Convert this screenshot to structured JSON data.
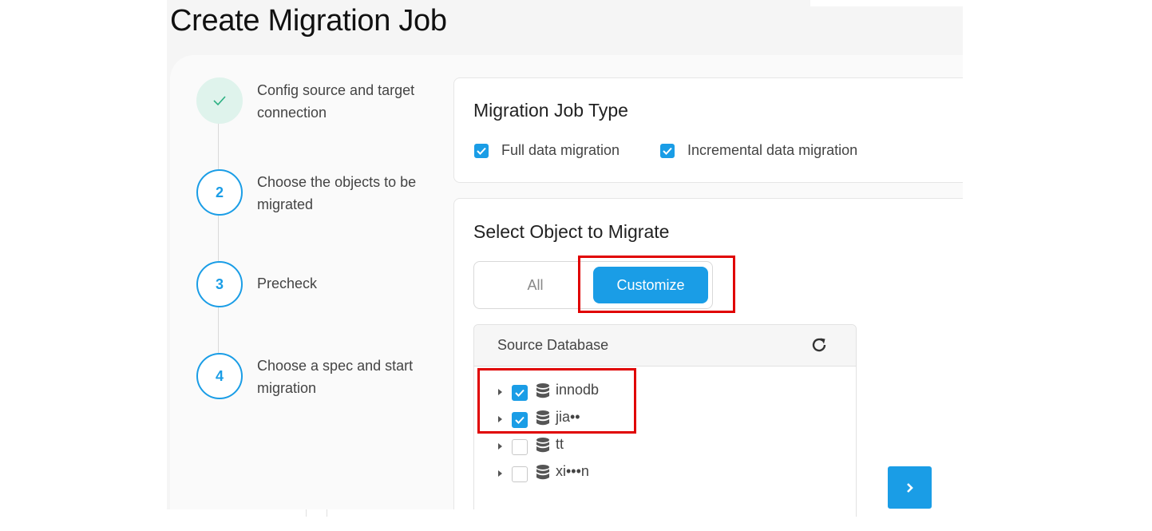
{
  "page": {
    "title": "Create Migration Job"
  },
  "steps": [
    {
      "index": "",
      "label": "Config source and target connection",
      "status": "done",
      "icon": "check-icon"
    },
    {
      "index": "2",
      "label": "Choose the objects to be migrated",
      "status": "active"
    },
    {
      "index": "3",
      "label": "Precheck",
      "status": "pending"
    },
    {
      "index": "4",
      "label": "Choose a spec and start migration",
      "status": "pending"
    }
  ],
  "job_type": {
    "title": "Migration Job Type",
    "options": [
      {
        "label": "Full data migration",
        "checked": true
      },
      {
        "label": "Incremental data migration",
        "checked": true
      }
    ]
  },
  "select_object": {
    "title": "Select Object to Migrate",
    "modes": [
      {
        "label": "All",
        "selected": false
      },
      {
        "label": "Customize",
        "selected": true
      }
    ],
    "tree": {
      "header": "Source Database",
      "refresh_icon": "refresh-icon",
      "databases": [
        {
          "name": "innodb",
          "checked": true,
          "icon": "database-icon"
        },
        {
          "name": "jia••",
          "checked": true,
          "icon": "database-icon",
          "redacted": true
        },
        {
          "name": "tt",
          "checked": false,
          "icon": "database-icon"
        },
        {
          "name": "xi•••n",
          "checked": false,
          "icon": "database-icon",
          "redacted": true
        }
      ]
    }
  },
  "next_button": {
    "icon": "chevron-right-icon"
  },
  "colors": {
    "accent": "#1a9de6",
    "highlight": "#e00000",
    "done_bg": "#dff3ec",
    "done_check": "#2bb082"
  }
}
